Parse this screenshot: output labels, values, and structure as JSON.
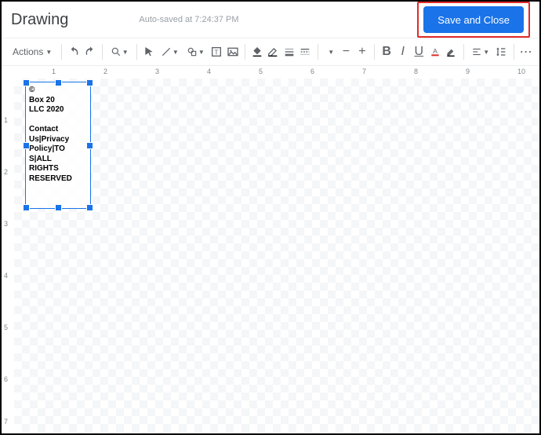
{
  "header": {
    "title": "Drawing",
    "autosave": "Auto-saved at 7:24:37 PM",
    "save_close": "Save and Close"
  },
  "toolbar": {
    "actions_label": "Actions",
    "zoom": "–"
  },
  "ruler": {
    "h_ticks": [
      "1",
      "2",
      "3",
      "4",
      "5",
      "6",
      "7",
      "8",
      "9",
      "10"
    ],
    "v_ticks": [
      "1",
      "2",
      "3",
      "4",
      "5",
      "6",
      "7"
    ]
  },
  "shape": {
    "line1": "©",
    "line2": "Box 20",
    "line3": "LLC 2020",
    "line4": "",
    "line5": "Contact",
    "line6": "Us|Privacy",
    "line7": "Policy|TO",
    "line8": "S|ALL",
    "line9": "RIGHTS",
    "line10": "RESERVED"
  }
}
